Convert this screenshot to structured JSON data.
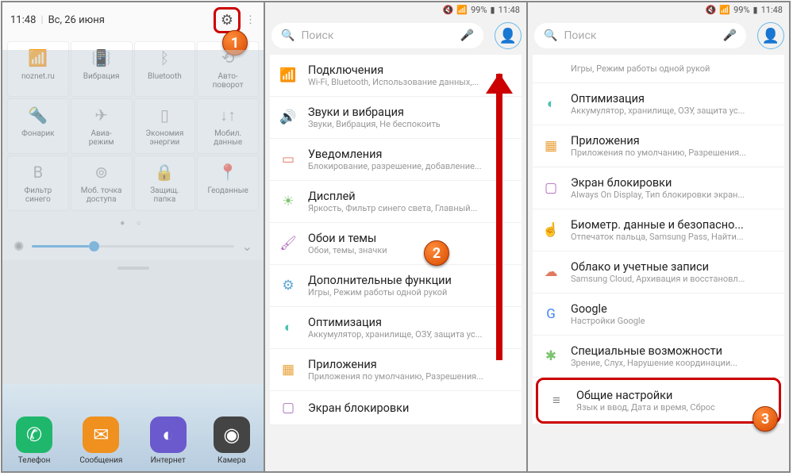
{
  "panel1": {
    "time": "11:48",
    "date": "Вс, 26 июня",
    "badge": "1",
    "tiles": [
      {
        "label": "noznet.ru",
        "icon": "wifi",
        "on": true
      },
      {
        "label": "Вибрация",
        "icon": "vibrate"
      },
      {
        "label": "Bluetooth",
        "icon": "bt"
      },
      {
        "label": "Авто-\nповорот",
        "icon": "rotate"
      },
      {
        "label": "Фонарик",
        "icon": "flash"
      },
      {
        "label": "Авиа-\nрежим",
        "icon": "plane"
      },
      {
        "label": "Экономия\nэнергии",
        "icon": "battery"
      },
      {
        "label": "Мобил.\nданные",
        "icon": "data"
      },
      {
        "label": "Фильтр\nсинего",
        "icon": "filter"
      },
      {
        "label": "Моб. точка\nдоступа",
        "icon": "hotspot"
      },
      {
        "label": "Защищ.\nпапка",
        "icon": "secure"
      },
      {
        "label": "Геоданные",
        "icon": "geo",
        "on": true
      }
    ],
    "apps": [
      {
        "label": "Телефон",
        "color": "#1fb76c",
        "glyph": "✆"
      },
      {
        "label": "Сообщения",
        "color": "#f0901e",
        "glyph": "✉"
      },
      {
        "label": "Интернет",
        "color": "#6a5acd",
        "glyph": "◐"
      },
      {
        "label": "Камера",
        "color": "#444",
        "glyph": "◉"
      }
    ]
  },
  "status": {
    "battery": "99%",
    "time": "11:48"
  },
  "search": {
    "placeholder": "Поиск"
  },
  "panel2": {
    "badge": "2",
    "rows": [
      {
        "icon": "📶",
        "c": "#5aa7d6",
        "t": "Подключения",
        "s": "Wi-Fi, Bluetooth, Использование данных,..."
      },
      {
        "icon": "🔊",
        "c": "#5aa7d6",
        "t": "Звуки и вибрация",
        "s": "Звуки, Вибрация, Не беспокоить"
      },
      {
        "icon": "▭",
        "c": "#e07a5f",
        "t": "Уведомления",
        "s": "Блокирование, разрешение, добавление..."
      },
      {
        "icon": "☀",
        "c": "#7cc36e",
        "t": "Дисплей",
        "s": "Яркость, Фильтр синего света, Главный..."
      },
      {
        "icon": "🖌",
        "c": "#b070c0",
        "t": "Обои и темы",
        "s": "Обои, темы, значки"
      },
      {
        "icon": "⚙",
        "c": "#5aa7d6",
        "t": "Дополнительные функции",
        "s": "Игры, Режим работы одной рукой"
      },
      {
        "icon": "◐",
        "c": "#4cc0b0",
        "t": "Оптимизация",
        "s": "Аккумулятор, хранилище, ОЗУ, защита ус..."
      },
      {
        "icon": "▦",
        "c": "#e8a23a",
        "t": "Приложения",
        "s": "Приложения по умолчанию, Разрешения..."
      },
      {
        "icon": "▢",
        "c": "#b070c0",
        "t": "Экран блокировки",
        "s": ""
      }
    ]
  },
  "panel3": {
    "badge": "3",
    "rows": [
      {
        "icon": "",
        "c": "",
        "t": "",
        "s": "Игры, Режим работы одной рукой"
      },
      {
        "icon": "◐",
        "c": "#4cc0b0",
        "t": "Оптимизация",
        "s": "Аккумулятор, хранилище, ОЗУ, защита ус..."
      },
      {
        "icon": "▦",
        "c": "#e8a23a",
        "t": "Приложения",
        "s": "Приложения по умолчанию, Разрешения..."
      },
      {
        "icon": "▢",
        "c": "#b070c0",
        "t": "Экран блокировки",
        "s": "Always On Display, Тип блокировки экран..."
      },
      {
        "icon": "☝",
        "c": "#5aa7d6",
        "t": "Биометр. данные и безопасно...",
        "s": "Отпечаток пальца, Samsung Pass, Найти..."
      },
      {
        "icon": "☁",
        "c": "#e07a5f",
        "t": "Облако и учетные записи",
        "s": "Samsung Cloud, Архивация и восстановл..."
      },
      {
        "icon": "G",
        "c": "#4285f4",
        "t": "Google",
        "s": "Настройки Google"
      },
      {
        "icon": "✱",
        "c": "#7cc36e",
        "t": "Специальные возможности",
        "s": "Зрение, Слух, Нарушение координации..."
      },
      {
        "icon": "≡",
        "c": "#888",
        "t": "Общие настройки",
        "s": "Язык и ввод, Дата и время, Сброс",
        "hl": true
      }
    ]
  }
}
